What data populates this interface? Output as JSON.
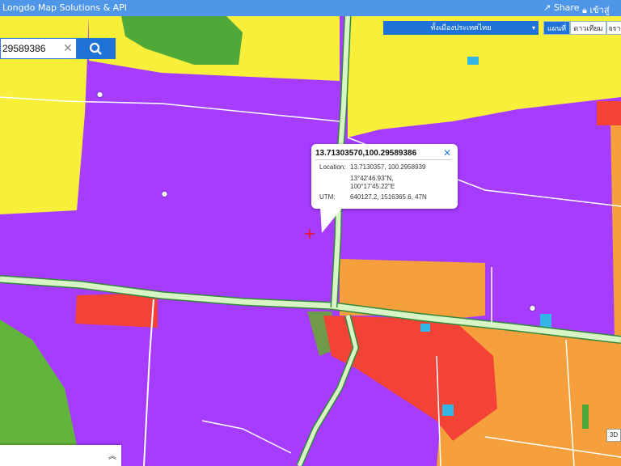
{
  "header": {
    "title": "Longdo Map Solutions & API",
    "share": "Share",
    "login": "เข้าสู่ระบบ"
  },
  "search": {
    "value": "29589386"
  },
  "province_dropdown": {
    "label": "ทั้งเมืองประเทศไทย"
  },
  "map_type_buttons": [
    "แผนที่",
    "ดาวเทียม",
    "จราจร"
  ],
  "popup": {
    "title": "13.71303570,100.29589386",
    "location_label": "Location:",
    "location_decimal": "13.7130357, 100.2958939",
    "location_dms_lat": "13°42'46.93\"N,",
    "location_dms_lon": "100°17'45.22\"E",
    "utm_label": "UTM:",
    "utm_value": "640127.2, 1516365.6, 47N"
  },
  "controls": {
    "three_d": "3D"
  },
  "colors": {
    "residential_high": "#a63cff",
    "residential_low": "#f7ef3a",
    "commercial": "#f24336",
    "industrial": "#f5a03c",
    "agriculture": "#62b53a",
    "road": "#d9f5c6",
    "water": "#33b5e5"
  },
  "icons": [
    "search-icon",
    "clear-icon",
    "close-icon",
    "share-icon",
    "lock-icon",
    "chevron-up-icon",
    "location-marker"
  ]
}
